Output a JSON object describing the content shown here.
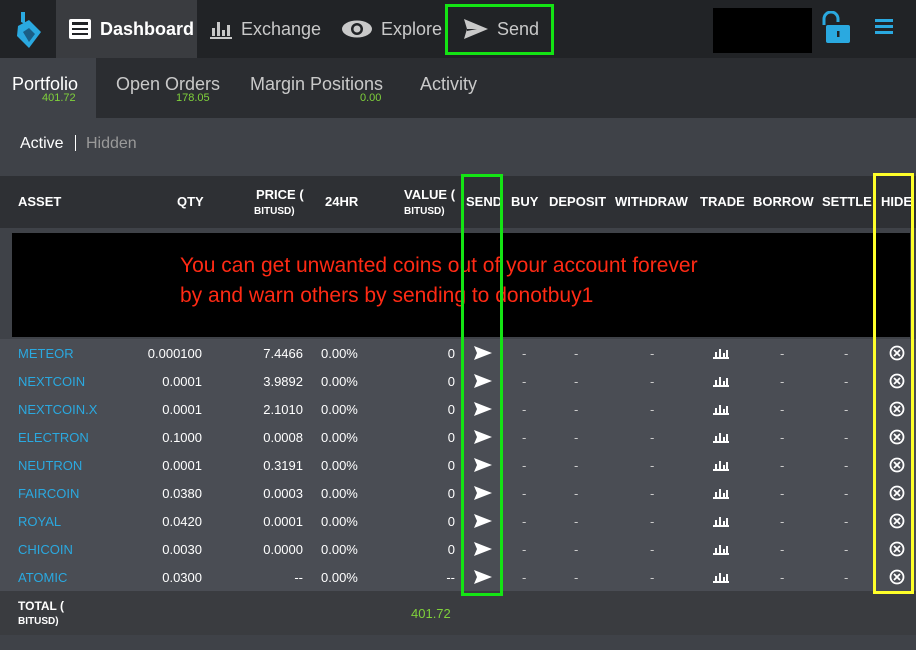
{
  "nav": {
    "items": [
      {
        "label": "Dashboard",
        "icon": "dashboard-icon"
      },
      {
        "label": "Exchange",
        "icon": "chart-icon"
      },
      {
        "label": "Explore",
        "icon": "eye-icon"
      },
      {
        "label": "Send",
        "icon": "send-icon"
      }
    ],
    "lock_icon": "unlock-icon",
    "menu_icon": "hamburger-icon"
  },
  "tabs": [
    {
      "label": "Portfolio",
      "value": "401.72"
    },
    {
      "label": "Open Orders",
      "value": "178.05"
    },
    {
      "label": "Margin Positions",
      "value": "0.00"
    },
    {
      "label": "Activity",
      "value": ""
    }
  ],
  "subtabs": {
    "active": "Active",
    "hidden": "Hidden"
  },
  "table": {
    "headers": {
      "asset": "ASSET",
      "qty": "QTY",
      "price": "PRICE (",
      "price_unit": "BITUSD)",
      "change": "24HR",
      "value": "VALUE (",
      "value_unit": "BITUSD)",
      "send": "SEND",
      "buy": "BUY",
      "deposit": "DEPOSIT",
      "withdraw": "WITHDRAW",
      "trade": "TRADE",
      "borrow": "BORROW",
      "settle": "SETTLE",
      "hide": "HIDE"
    },
    "rows": [
      {
        "asset": "METEOR",
        "qty": "0.000100",
        "price": "7.4466",
        "change": "0.00%",
        "value": "0",
        "buy": "-",
        "deposit": "-",
        "withdraw": "-",
        "borrow": "-",
        "settle": "-"
      },
      {
        "asset": "NEXTCOIN",
        "qty": "0.0001",
        "price": "3.9892",
        "change": "0.00%",
        "value": "0",
        "buy": "-",
        "deposit": "-",
        "withdraw": "-",
        "borrow": "-",
        "settle": "-"
      },
      {
        "asset": "NEXTCOIN.X",
        "qty": "0.0001",
        "price": "2.1010",
        "change": "0.00%",
        "value": "0",
        "buy": "-",
        "deposit": "-",
        "withdraw": "-",
        "borrow": "-",
        "settle": "-"
      },
      {
        "asset": "ELECTRON",
        "qty": "0.1000",
        "price": "0.0008",
        "change": "0.00%",
        "value": "0",
        "buy": "-",
        "deposit": "-",
        "withdraw": "-",
        "borrow": "-",
        "settle": "-"
      },
      {
        "asset": "NEUTRON",
        "qty": "0.0001",
        "price": "0.3191",
        "change": "0.00%",
        "value": "0",
        "buy": "-",
        "deposit": "-",
        "withdraw": "-",
        "borrow": "-",
        "settle": "-"
      },
      {
        "asset": "FAIRCOIN",
        "qty": "0.0380",
        "price": "0.0003",
        "change": "0.00%",
        "value": "0",
        "buy": "-",
        "deposit": "-",
        "withdraw": "-",
        "borrow": "-",
        "settle": "-"
      },
      {
        "asset": "ROYAL",
        "qty": "0.0420",
        "price": "0.0001",
        "change": "0.00%",
        "value": "0",
        "buy": "-",
        "deposit": "-",
        "withdraw": "-",
        "borrow": "-",
        "settle": "-"
      },
      {
        "asset": "CHICOIN",
        "qty": "0.0030",
        "price": "0.0000",
        "change": "0.00%",
        "value": "0",
        "buy": "-",
        "deposit": "-",
        "withdraw": "-",
        "borrow": "-",
        "settle": "-"
      },
      {
        "asset": "ATOMIC",
        "qty": "0.0300",
        "price": "--",
        "change": "0.00%",
        "value": "--",
        "buy": "-",
        "deposit": "-",
        "withdraw": "-",
        "borrow": "-",
        "settle": "-"
      }
    ],
    "total_label": "TOTAL (",
    "total_unit": "BITUSD)",
    "total_value": "401.72"
  },
  "notice": {
    "line1": "You can get unwanted coins out of your account forever",
    "line2": "by and warn others by sending to  donotbuy1"
  },
  "colors": {
    "accent_blue": "#2aa9e0",
    "positive_green": "#7fd13b",
    "highlight_green": "#14e414",
    "highlight_yellow": "#ffff2a",
    "notice_red": "#ff2a14"
  }
}
